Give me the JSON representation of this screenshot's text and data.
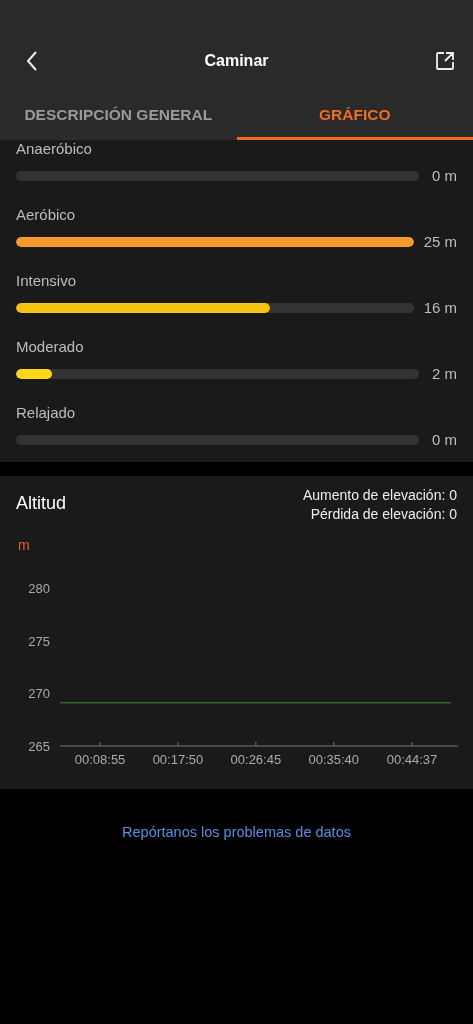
{
  "header": {
    "title": "Caminar"
  },
  "tabs": [
    {
      "label": "DESCRIPCIÓN GENERAL",
      "selected": false
    },
    {
      "label": "GRÁFICO",
      "selected": true
    }
  ],
  "zones": [
    {
      "name": "Anaeróbico",
      "reading": "0 m"
    },
    {
      "name": "Aeróbico",
      "level": 1,
      "reading": "25 m",
      "color": "#f89b2c"
    },
    {
      "name": "Intensivo",
      "level": 0.64,
      "reading": "16 m",
      "color": "#f6c313"
    },
    {
      "name": "Moderado",
      "level": 0.09,
      "reading": "2 m",
      "color": "#f8d91a"
    },
    {
      "name": "Relajado",
      "reading": "0 m"
    }
  ],
  "altitude": {
    "title": "Altitud",
    "gain": "Aumento de elevación: 0",
    "loss": "Pérdida de elevación: 0",
    "unit": "m",
    "chart_data": {
      "type": "line",
      "x": [
        261,
        2943
      ],
      "xlim": [
        260,
        2993
      ],
      "ylim": [
        265,
        280
      ],
      "yticks": [
        265,
        270,
        275,
        280
      ],
      "xticks": [
        {
          "value": 535,
          "label": "00:08:55"
        },
        {
          "value": 1070,
          "label": "00:17:50"
        },
        {
          "value": 1605,
          "label": "00:26:45"
        },
        {
          "value": 2140,
          "label": "00:35:40"
        },
        {
          "value": 2677,
          "label": "00:44:37"
        }
      ],
      "series": [
        {
          "color": "#4f8a3a",
          "values": [
            269.1,
            269.1
          ]
        }
      ]
    }
  },
  "report_link": "Repórtanos los problemas de datos"
}
